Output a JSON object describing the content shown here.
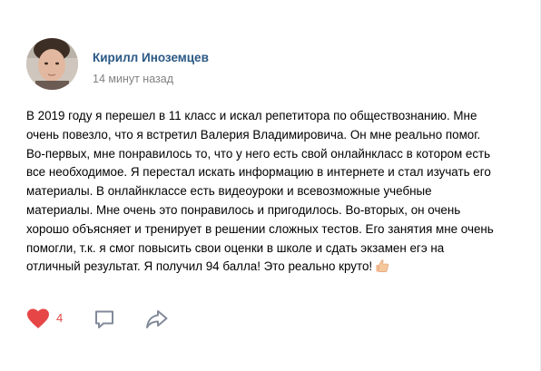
{
  "post": {
    "author": "Кирилл Иноземцев",
    "time": "14 минут назад",
    "text_lines": [
      "В 2019 году я перешел в 11 класс и искал репетитора по обществознанию. Мне",
      "очень повезло, что я встретил Валерия Владимировича. Он мне реально помог.",
      "Во-первых, мне понравилось то, что у него есть свой онлайнкласс в котором есть",
      "все необходимое. Я перестал искать информацию в интернете и стал изучать его",
      "материалы. В онлайнклассе есть видеоуроки и всевозможные учебные",
      "материалы. Мне очень это понравилось и пригодилось. Во-вторых, он очень",
      "хорошо объясняет и тренирует в решении сложных тестов. Его занятия мне очень",
      "помогли, т.к. я смог повысить свои оценки в школе и сдать экзамен егэ на",
      "отличный результат. Я получил 94 балла! Это реально круто!"
    ],
    "emoji": "thumbs-up-icon"
  },
  "actions": {
    "like_count": "4",
    "like_icon": "heart-icon",
    "comment_icon": "comment-icon",
    "share_icon": "share-icon"
  },
  "colors": {
    "author_link": "#2a5885",
    "time_text": "#828282",
    "like_active": "#e64646",
    "action_icon": "#828a99"
  }
}
